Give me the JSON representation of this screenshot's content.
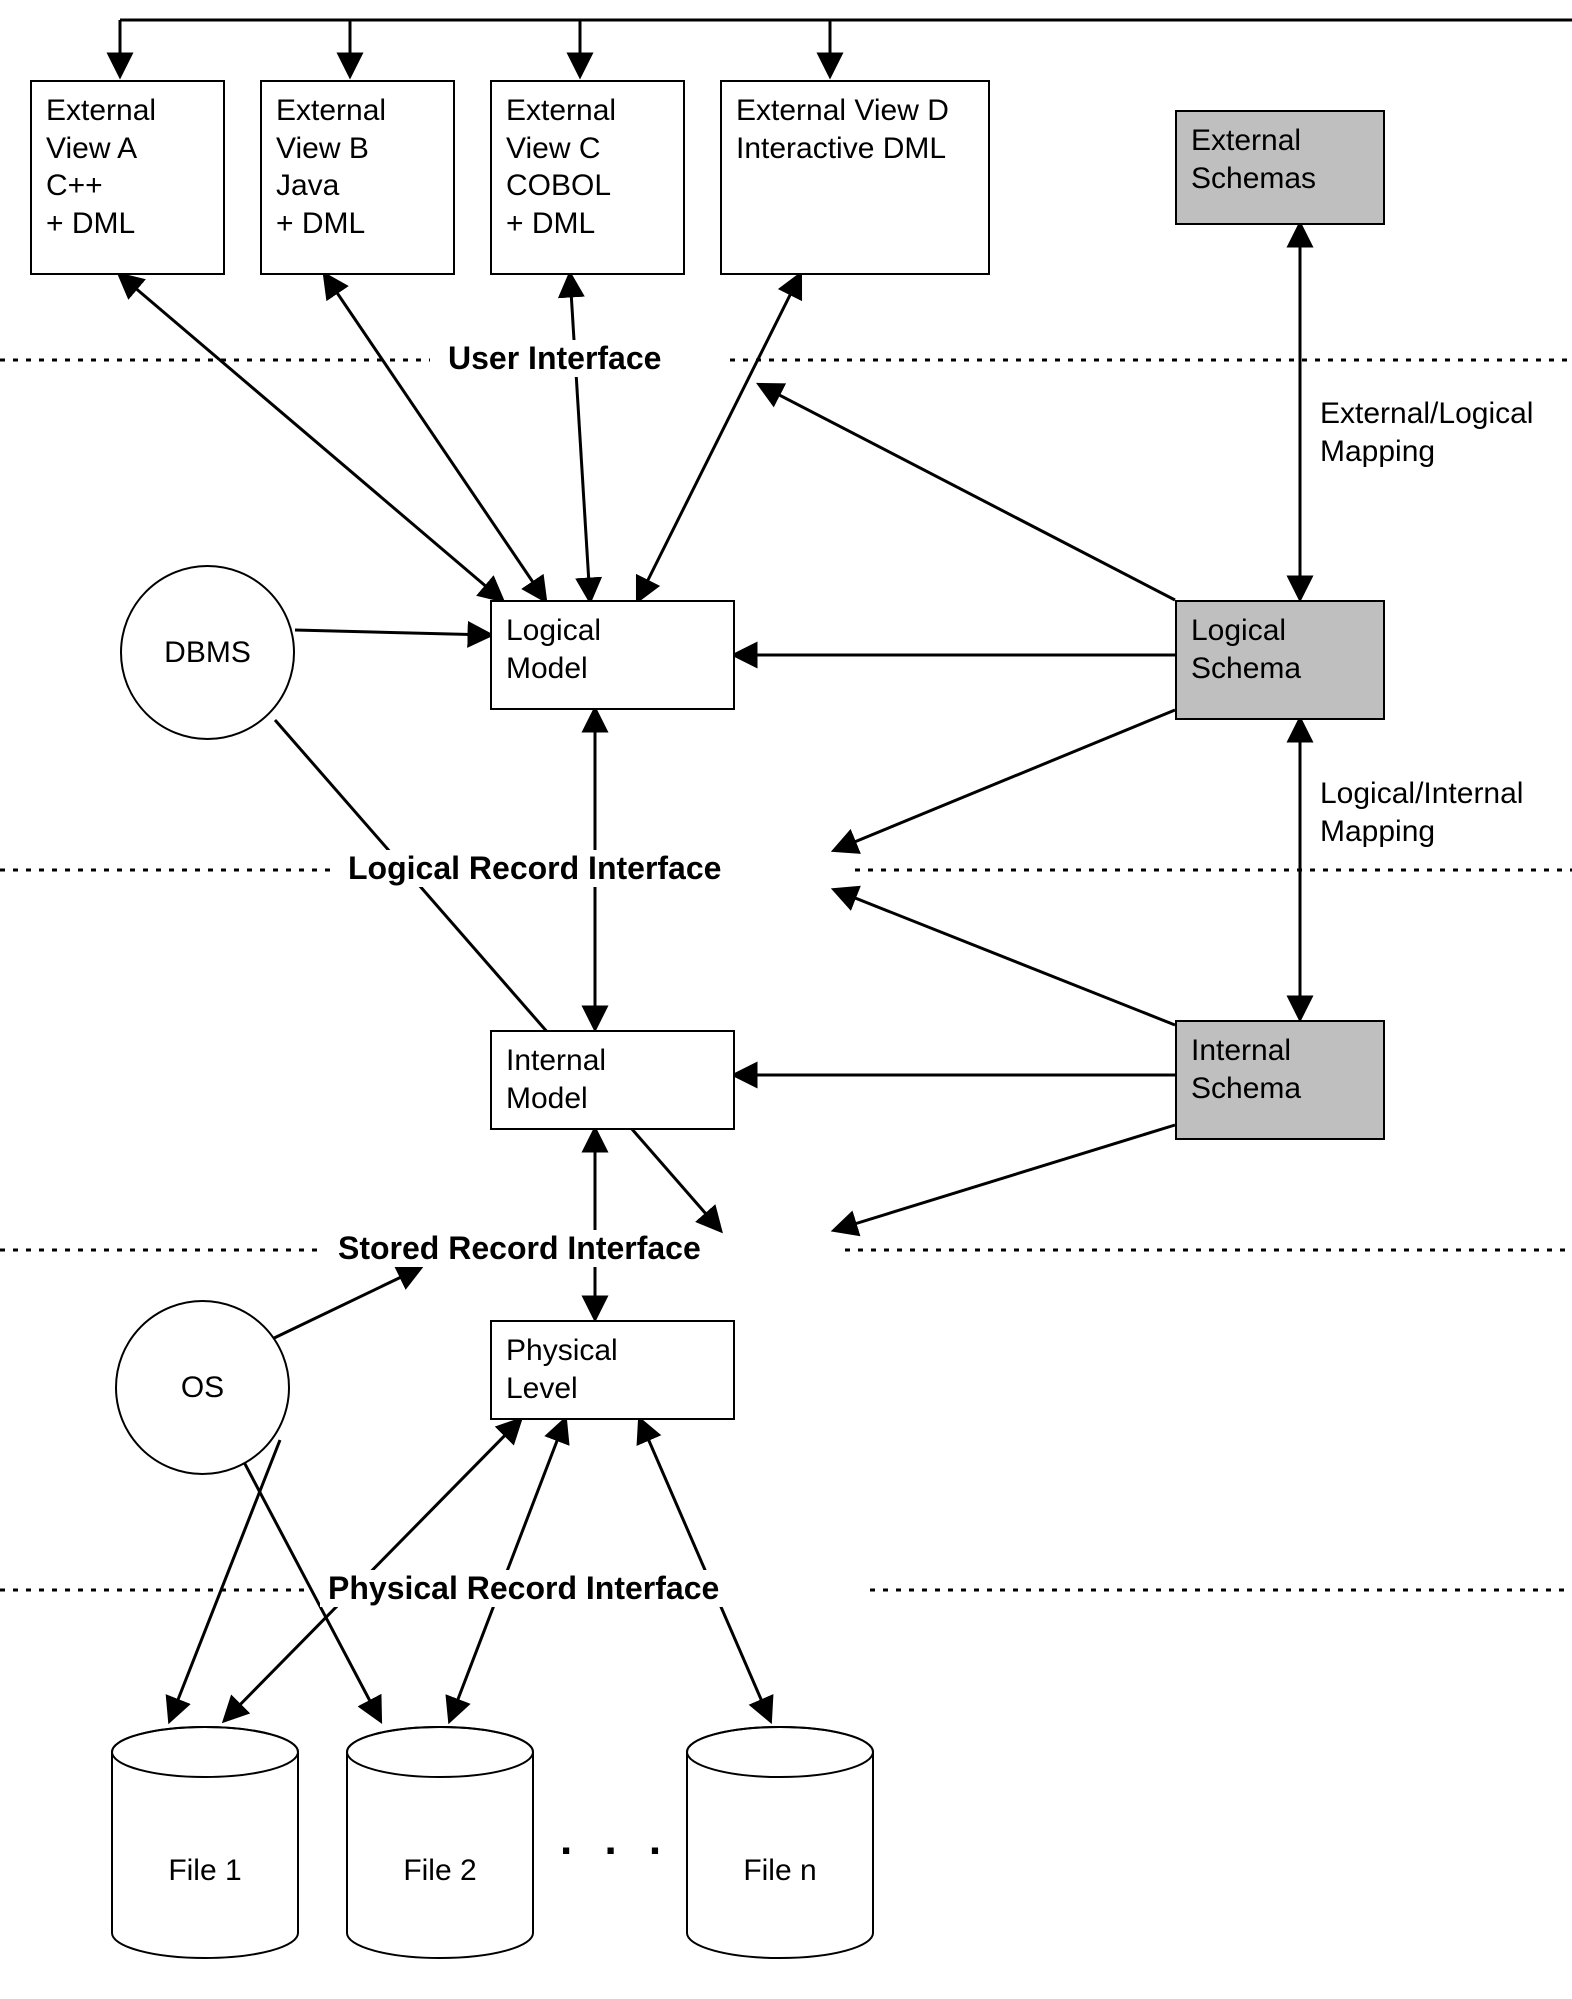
{
  "external_views": {
    "a": "External\nView A\nC++\n+ DML",
    "b": "External\nView B\nJava\n+ DML",
    "c": "External\nView C\nCOBOL\n+ DML",
    "d": "External View D\nInteractive DML"
  },
  "schemas": {
    "external": "External\nSchemas",
    "logical": "Logical\nSchema",
    "internal": "Internal\nSchema"
  },
  "models": {
    "logical": "Logical\nModel",
    "internal": "Internal\nModel",
    "physical": "Physical\nLevel"
  },
  "circles": {
    "dbms": "DBMS",
    "os": "OS"
  },
  "interfaces": {
    "user": "User Interface",
    "logical": "Logical Record Interface",
    "stored": "Stored Record Interface",
    "physical": "Physical Record Interface"
  },
  "mappings": {
    "ext_log": "External/Logical\nMapping",
    "log_int": "Logical/Internal\nMapping"
  },
  "files": {
    "f1": "File 1",
    "f2": "File 2",
    "fn": "File n",
    "dots": ". . ."
  }
}
